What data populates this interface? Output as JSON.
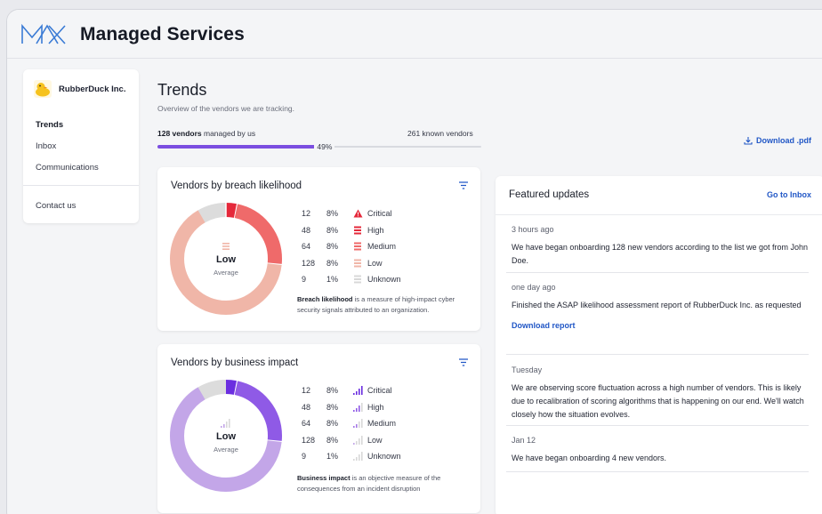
{
  "app": {
    "title": "Managed Services"
  },
  "sidebar": {
    "org_name": "RubberDuck Inc.",
    "items": [
      {
        "label": "Trends",
        "active": true
      },
      {
        "label": "Inbox"
      },
      {
        "label": "Communications"
      }
    ],
    "contact_label": "Contact us"
  },
  "page": {
    "title": "Trends",
    "subtitle": "Overview of the vendors we are tracking.",
    "managed_count": "128 vendors",
    "managed_suffix": "managed by us",
    "known_vendors": "261 known vendors",
    "progress_percent": 49,
    "progress_label": "49%",
    "download_label": "Download .pdf"
  },
  "breach_card": {
    "title": "Vendors by breach likelihood",
    "center_label": "Low",
    "center_sub": "Average",
    "note_bold": "Breach likelihood",
    "note_text": " is a measure of high-impact cyber security signals attributed to an organization.",
    "rows": [
      {
        "count": "12",
        "pct": "8%",
        "label": "Critical",
        "icon": "triangle-alert-icon"
      },
      {
        "count": "48",
        "pct": "8%",
        "label": "High",
        "icon": "bars-high-icon"
      },
      {
        "count": "64",
        "pct": "8%",
        "label": "Medium",
        "icon": "bars-medium-icon"
      },
      {
        "count": "128",
        "pct": "8%",
        "label": "Low",
        "icon": "bars-low-icon"
      },
      {
        "count": "9",
        "pct": "1%",
        "label": "Unknown",
        "icon": "bars-unknown-icon"
      }
    ]
  },
  "impact_card": {
    "title": "Vendors by business impact",
    "center_label": "Low",
    "center_sub": "Average",
    "note_bold": "Business impact",
    "note_text": " is an objective measure of the consequences from an incident disruption",
    "rows": [
      {
        "count": "12",
        "pct": "8%",
        "label": "Critical",
        "icon": "signal-critical-icon"
      },
      {
        "count": "48",
        "pct": "8%",
        "label": "High",
        "icon": "signal-high-icon"
      },
      {
        "count": "64",
        "pct": "8%",
        "label": "Medium",
        "icon": "signal-medium-icon"
      },
      {
        "count": "128",
        "pct": "8%",
        "label": "Low",
        "icon": "signal-low-icon"
      },
      {
        "count": "9",
        "pct": "1%",
        "label": "Unknown",
        "icon": "signal-unknown-icon"
      }
    ]
  },
  "updates": {
    "title": "Featured updates",
    "goto_label": "Go to Inbox",
    "items": [
      {
        "time": "3 hours ago",
        "text": "We have began onboarding 128 new vendors according to the list we got from John Doe."
      },
      {
        "time": "one day ago",
        "text": "Finished the ASAP likelihood assessment report of RubberDuck Inc. as requested",
        "link": "Download report"
      },
      {
        "time": "Tuesday",
        "text": "We are observing score fluctuation across a high number of vendors. This is likely due to recalibration of scoring algorithms that is happening on our end. We'll watch closely how the situation evolves."
      },
      {
        "time": "Jan 12",
        "text": "We have began onboarding 4 new vendors."
      }
    ]
  },
  "colors": {
    "accent": "#7b4ee0",
    "link": "#2157c6",
    "critical_red": "#e5283a",
    "high_red": "#ef6a6a",
    "medium_salmon": "#f0b6a8",
    "unknown_gray": "#dcdcdc",
    "purple_critical": "#6b2ee0",
    "purple_high": "#8f5ae6",
    "purple_low": "#c3a6e8"
  }
}
